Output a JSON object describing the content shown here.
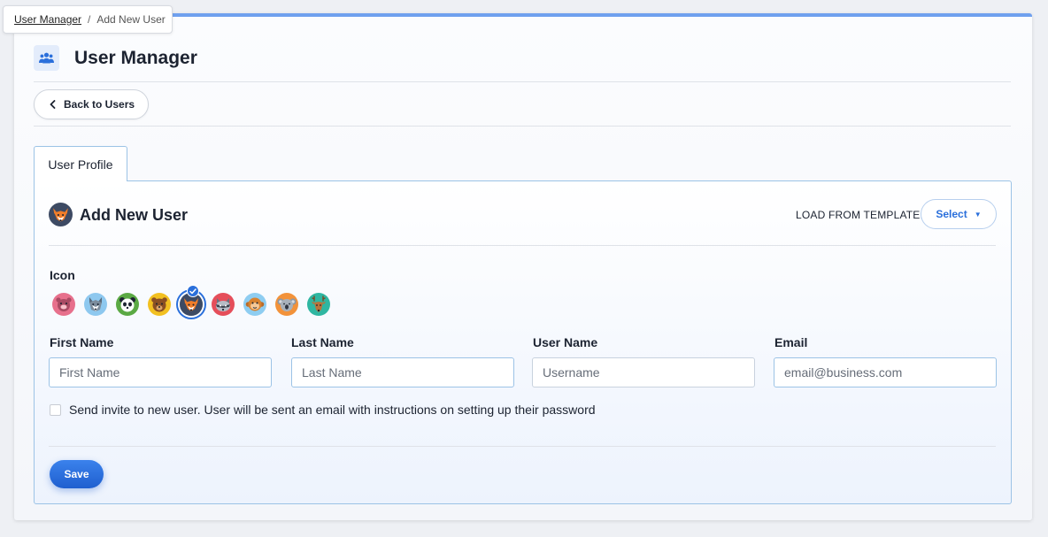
{
  "breadcrumb": {
    "parent": "User Manager",
    "separator": "/",
    "current": "Add New User"
  },
  "header": {
    "title": "User Manager",
    "icon": "users-icon"
  },
  "back_button": {
    "label": "Back to Users",
    "icon": "chevron-left-icon"
  },
  "tabs": [
    {
      "label": "User Profile",
      "active": true
    }
  ],
  "form": {
    "title": "Add New User",
    "template_label": "LOAD FROM TEMPLATE:",
    "template_select": "Select",
    "icon_label": "Icon",
    "icons": [
      {
        "name": "pig-icon",
        "color": "#e7708c",
        "selected": false
      },
      {
        "name": "husky-icon",
        "color": "#8ec8ef",
        "selected": false
      },
      {
        "name": "panda-icon",
        "color": "#5ba944",
        "selected": false
      },
      {
        "name": "bear-icon",
        "color": "#f2c021",
        "selected": false
      },
      {
        "name": "fox-icon",
        "color": "#3d4a63",
        "selected": true
      },
      {
        "name": "raccoon-icon",
        "color": "#e54e5a",
        "selected": false
      },
      {
        "name": "monkey-icon",
        "color": "#8ecdf1",
        "selected": false
      },
      {
        "name": "koala-icon",
        "color": "#f2923a",
        "selected": false
      },
      {
        "name": "deer-icon",
        "color": "#2fb6a1",
        "selected": false
      }
    ],
    "fields": [
      {
        "label": "First Name",
        "placeholder": "First Name",
        "value": ""
      },
      {
        "label": "Last Name",
        "placeholder": "Last Name",
        "value": ""
      },
      {
        "label": "User Name",
        "placeholder": "Username",
        "value": ""
      },
      {
        "label": "Email",
        "placeholder": "email@business.com",
        "value": ""
      }
    ],
    "invite_text": "Send invite to new user. User will be sent an email with instructions on setting up their password",
    "invite_checked": false,
    "save_label": "Save"
  },
  "colors": {
    "accent": "#2a6fdb",
    "top_bar": "#6fa0ee",
    "panel_border": "#9cc3e6"
  }
}
